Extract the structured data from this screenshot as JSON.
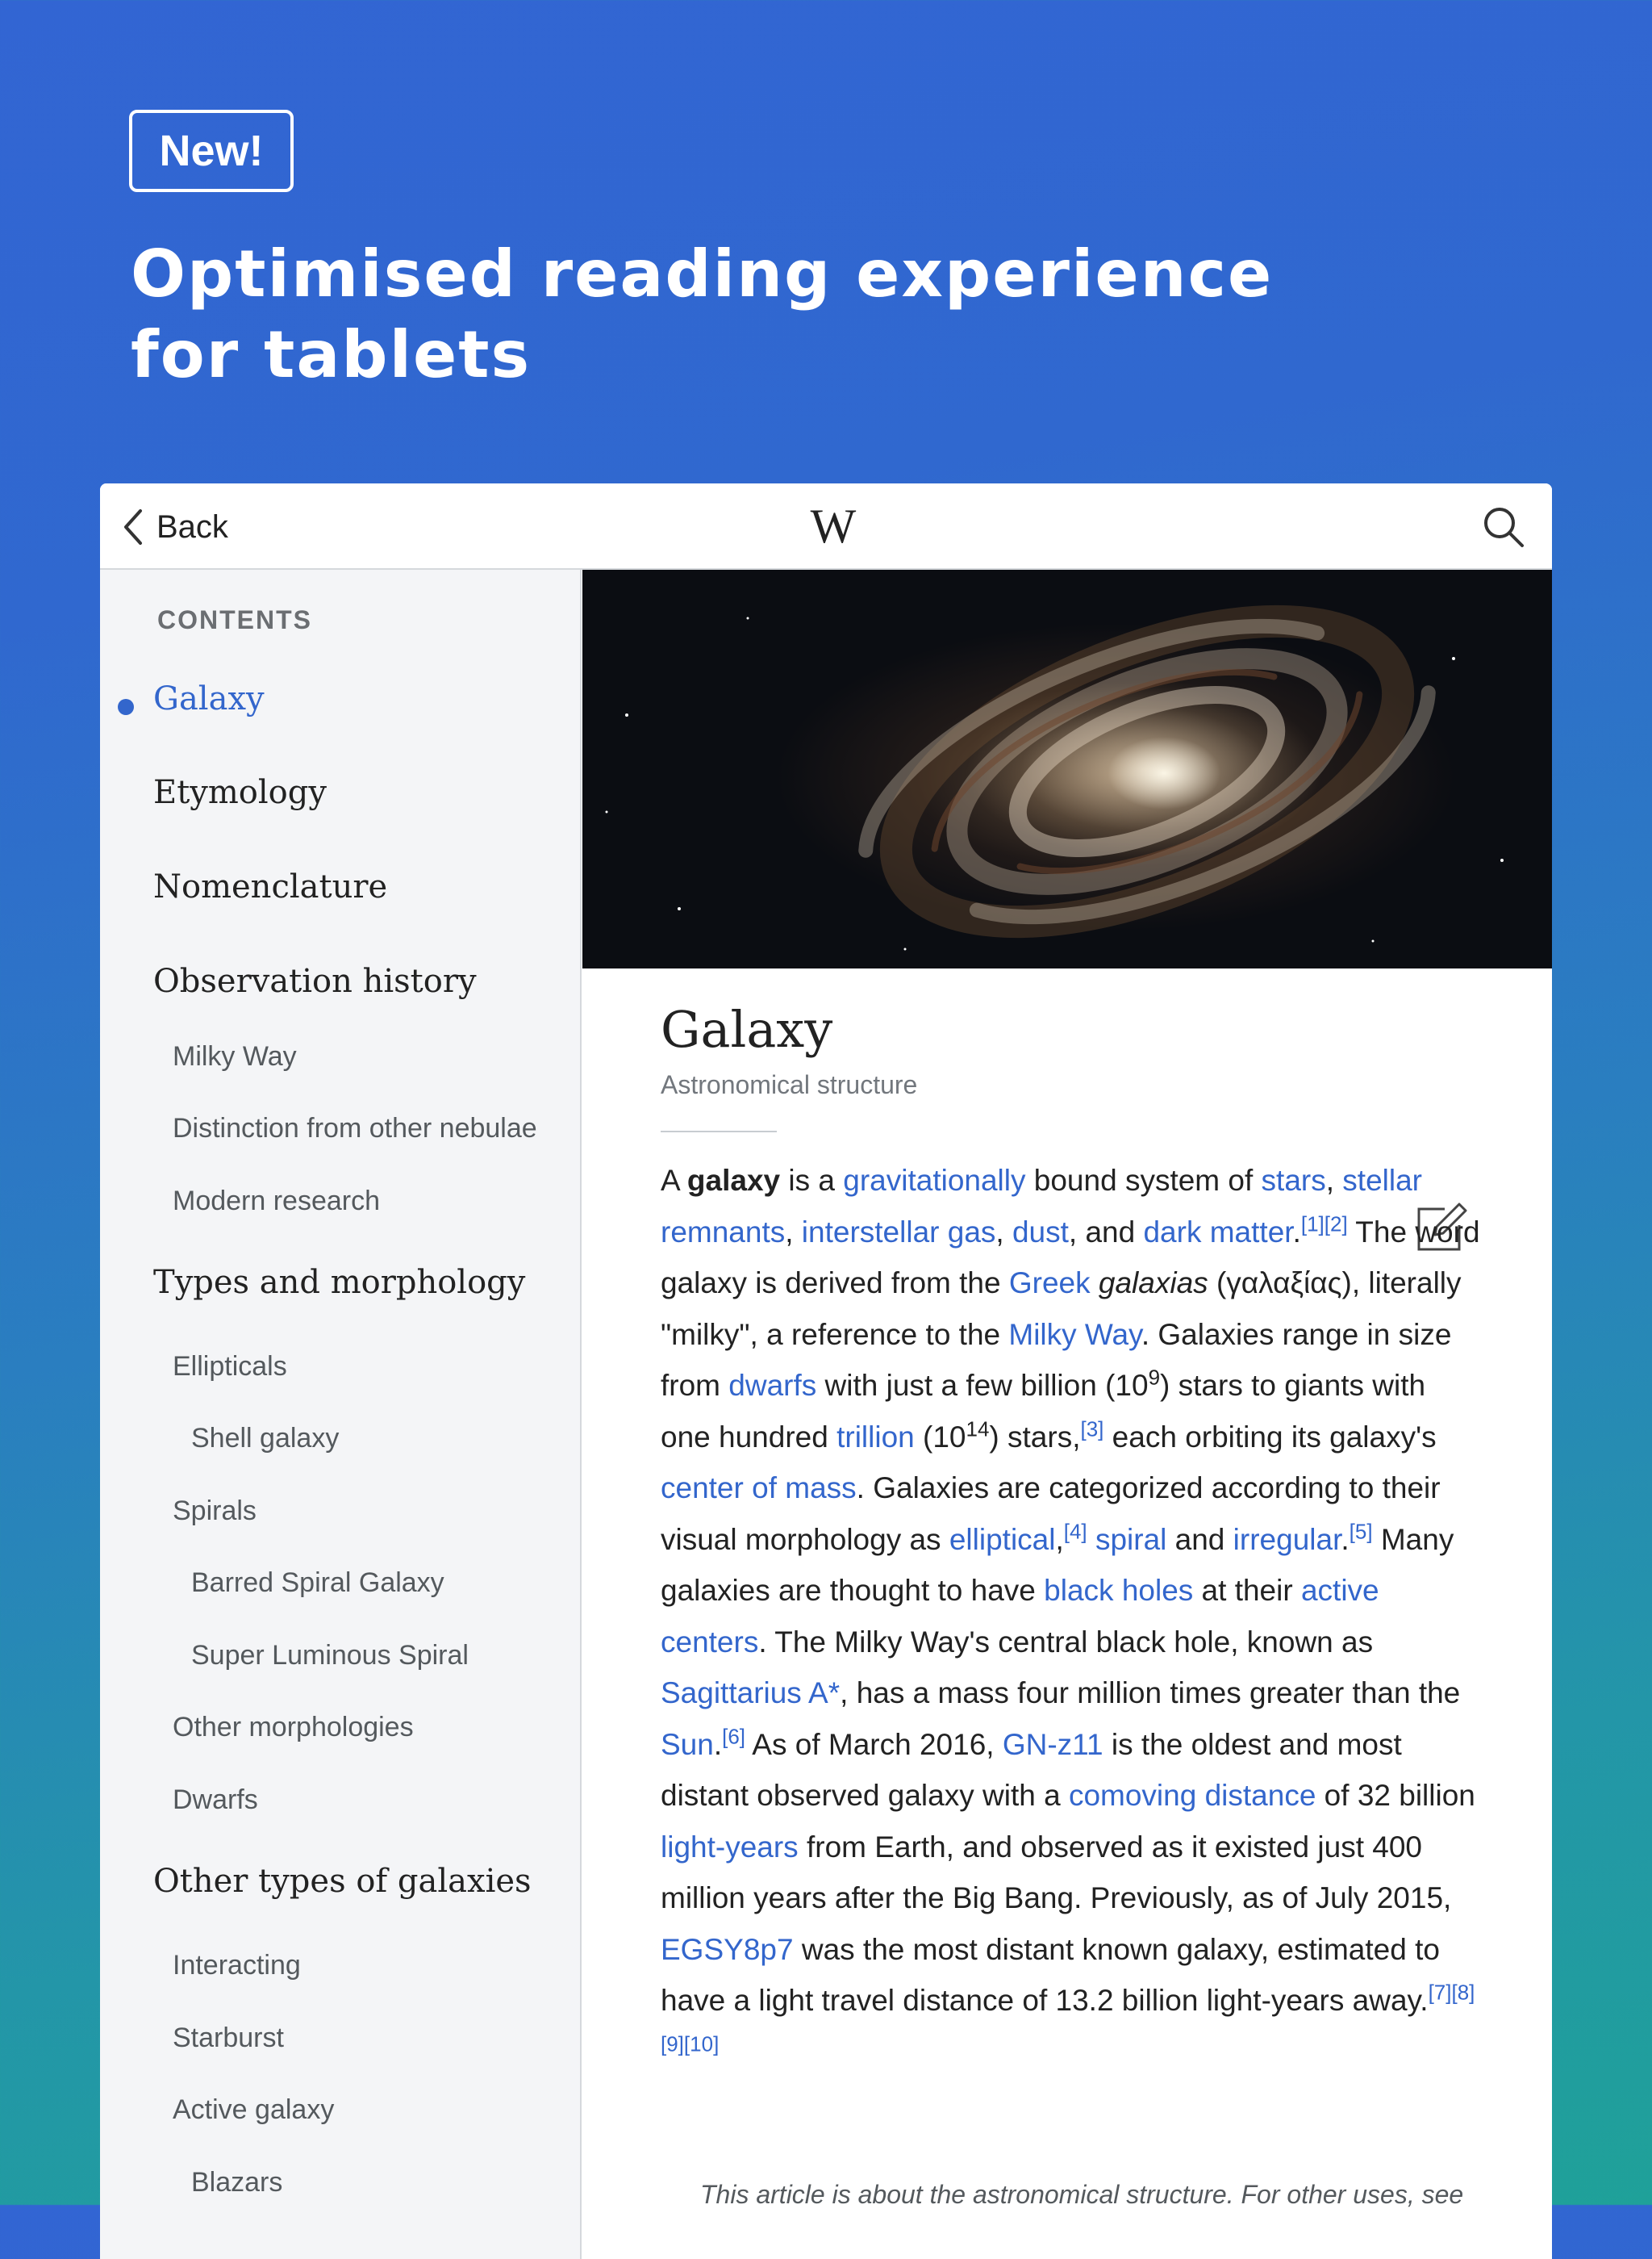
{
  "promo": {
    "badge": "New!",
    "headline_line1": "Optimised reading experience",
    "headline_line2": "for tablets",
    "background_colors": [
      "#3265d3",
      "#1fa199"
    ]
  },
  "toolbar": {
    "back_label": "Back",
    "logo_text": "W",
    "back_icon": "chevron-left-icon",
    "search_icon": "search-icon"
  },
  "toc": {
    "heading": "CONTENTS",
    "items": [
      {
        "label": "Galaxy",
        "level": 2,
        "active": true
      },
      {
        "label": "Etymology",
        "level": 2
      },
      {
        "label": "Nomenclature",
        "level": 2
      },
      {
        "label": "Observation history",
        "level": 2
      },
      {
        "label": "Milky Way",
        "level": 3
      },
      {
        "label": "Distinction from other nebulae",
        "level": 3
      },
      {
        "label": "Modern research",
        "level": 3
      },
      {
        "label": "Types and morphology",
        "level": 2
      },
      {
        "label": "Ellipticals",
        "level": 3
      },
      {
        "label": "Shell galaxy",
        "level": 4
      },
      {
        "label": "Spirals",
        "level": 3
      },
      {
        "label": "Barred Spiral Galaxy",
        "level": 4
      },
      {
        "label": "Super Luminous Spiral",
        "level": 4
      },
      {
        "label": "Other morphologies",
        "level": 3
      },
      {
        "label": "Dwarfs",
        "level": 3
      },
      {
        "label": "Other types of galaxies",
        "level": 2
      },
      {
        "label": "Interacting",
        "level": 3
      },
      {
        "label": "Starburst",
        "level": 3
      },
      {
        "label": "Active galaxy",
        "level": 3
      },
      {
        "label": "Blazars",
        "level": 4
      }
    ]
  },
  "article": {
    "title": "Galaxy",
    "subtitle": "Astronomical structure",
    "edit_icon": "pencil-edit-icon",
    "body": {
      "t01": "A ",
      "t02": "galaxy",
      "t03": " is a ",
      "l01": "gravitationally",
      "t04": " bound system of ",
      "l02": "stars",
      "t05": ", ",
      "l03": "stellar remnants",
      "t06": ", ",
      "l04": "interstellar gas",
      "t07": ", ",
      "l05": "dust",
      "t08": ", and ",
      "l06": "dark matter",
      "t09": ".",
      "r01": "[1]",
      "r02": "[2]",
      "t10": " The word galaxy is derived from the ",
      "l07": "Greek",
      "t11": " ",
      "t12": "galaxias",
      "t13": " (γαλαξίας), literally \"milky\", a reference to the ",
      "l08": "Milky Way",
      "t14": ". Galaxies range in size from ",
      "l09": "dwarfs",
      "t15": " with just a few billion (10",
      "s01": "9",
      "t16": ") stars to giants with one hundred ",
      "l10": "trillion",
      "t17": " (10",
      "s02": "14",
      "t18": ") stars,",
      "r03": "[3]",
      "t19": " each orbiting its galaxy's ",
      "l11": "center of mass",
      "t20": ". Galaxies are categorized according to their visual morphology as ",
      "l12": "elliptical",
      "t21": ",",
      "r04": "[4]",
      "t22": " ",
      "l13": "spiral",
      "t23": " and ",
      "l14": "irregular",
      "t24": ".",
      "r05": "[5]",
      "t25": " Many galaxies are thought to have ",
      "l15": "black holes",
      "t26": " at their ",
      "l16": "active centers",
      "t27": ". The Milky Way's central black hole, known as ",
      "l17": "Sagittarius A*",
      "t28": ", has a mass four million times greater than the ",
      "l18": "Sun",
      "t29": ".",
      "r06": "[6]",
      "t30": " As of March 2016, ",
      "l19": "GN-z11",
      "t31": " is the oldest and most distant observed galaxy with a ",
      "l20": "comoving distance",
      "t32": " of 32 billion ",
      "l21": "light-years",
      "t33": " from Earth, and observed as it existed just 400 million years after the Big Bang. Previously, as of July 2015, ",
      "l22": "EGSY8p7",
      "t34": " was the most distant known galaxy, estimated to have a light travel distance of 13.2 billion light-years away.",
      "r07": "[7]",
      "r08": "[8]",
      "r09": "[9]",
      "r10": "[10]"
    },
    "hatnote": "This article is about the astronomical structure. For other uses, see"
  },
  "colors": {
    "link": "#3366cc",
    "text": "#222222",
    "toc_background": "#f4f5f7"
  }
}
